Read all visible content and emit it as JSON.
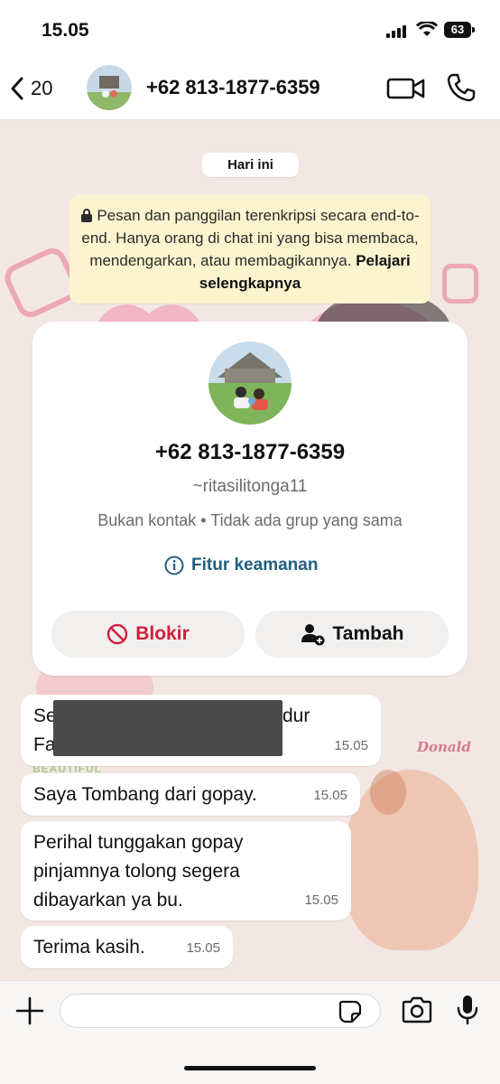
{
  "status_bar": {
    "time": "15.05",
    "battery": "63"
  },
  "header": {
    "back_count": "20",
    "title": "+62 813-1877-6359"
  },
  "date_separator": "Hari ini",
  "encryption_notice": {
    "text": "Pesan dan panggilan terenkripsi secara end-to-end. Hanya orang di chat ini yang bisa membaca, mendengarkan, atau membagikannya.",
    "link": "Pelajari selengkapnya"
  },
  "contact_card": {
    "phone": "+62 813-1877-6359",
    "username": "~ritasilitonga11",
    "info": "Bukan kontak • Tidak ada grup yang sama",
    "security_link": "Fitur keamanan",
    "block_label": "Blokir",
    "add_label": "Tambah"
  },
  "messages": [
    {
      "line1": "Se",
      "line1_end": "dur",
      "line2": "Fa",
      "time": "15.05",
      "redacted": true
    },
    {
      "text": "Saya Tombang dari gopay.",
      "time": "15.05"
    },
    {
      "text": "Perihal tunggakan gopay pinjamnya tolong segera dibayarkan ya bu.",
      "time": "15.05"
    },
    {
      "text": "Terima kasih.",
      "time": "15.05"
    }
  ],
  "wallpaper_text": [
    "Donald",
    "BEAUTIFUL"
  ],
  "input": {
    "placeholder": "",
    "value": ""
  },
  "colors": {
    "block_red": "#cf1f3b",
    "link_blue": "#1f5f80",
    "encryption_bg": "#fcf3cf",
    "wallpaper_bg": "#f3e7e3"
  },
  "icons": [
    "back-chevron-icon",
    "video-camera-icon",
    "phone-icon",
    "lock-icon",
    "info-icon",
    "block-icon",
    "add-person-icon",
    "plus-icon",
    "sticker-icon",
    "camera-icon",
    "mic-icon"
  ]
}
